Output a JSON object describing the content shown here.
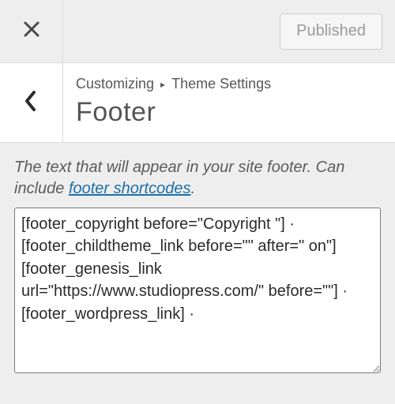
{
  "topbar": {
    "published_label": "Published"
  },
  "section": {
    "breadcrumb_root": "Customizing",
    "breadcrumb_current": "Theme Settings",
    "title": "Footer"
  },
  "description": {
    "pre": "The text that will appear in your site footer. Can include ",
    "link_text": "footer shortcodes",
    "post": "."
  },
  "footer_textarea": {
    "value": "[footer_copyright before=\"Copyright \"] · [footer_childtheme_link before=\"\" after=\" on\"] [footer_genesis_link url=\"https://www.studiopress.com/\" before=\"\"] · [footer_wordpress_link] ·"
  }
}
